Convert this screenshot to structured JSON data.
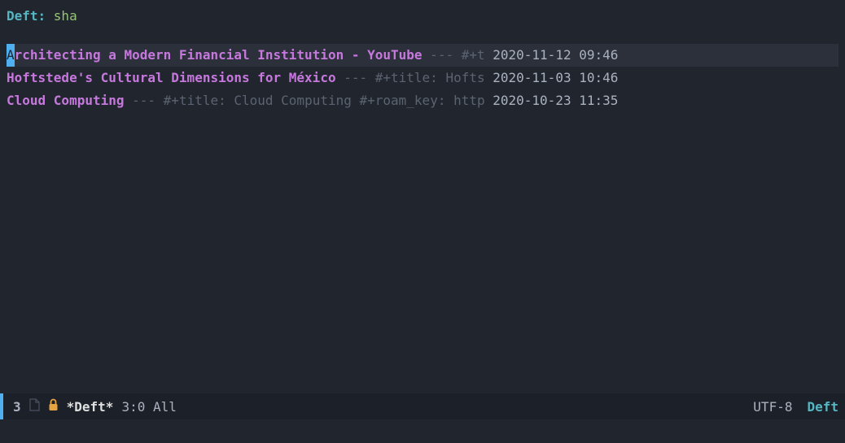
{
  "prompt": {
    "label": "Deft: ",
    "input": "sha"
  },
  "results": [
    {
      "cursor_char": "A",
      "title_rest": "rchitecting a Modern Financial Institution - YouTube",
      "separator": " --- ",
      "summary": "#+t ",
      "timestamp": "2020-11-12 09:46",
      "selected": true
    },
    {
      "title": "Hoftstede's Cultural Dimensions for México",
      "separator": " --- ",
      "summary": "#+title: Hofts ",
      "timestamp": "2020-11-03 10:46",
      "selected": false
    },
    {
      "title": "Cloud Computing",
      "separator": " --- ",
      "summary": "#+title: Cloud Computing #+roam_key: http ",
      "timestamp": "2020-10-23 11:35",
      "selected": false
    }
  ],
  "modeline": {
    "result_count": "3",
    "buffer_name": "*Deft*",
    "position": "3:0 All",
    "encoding": "UTF-8",
    "mode": "Deft"
  }
}
